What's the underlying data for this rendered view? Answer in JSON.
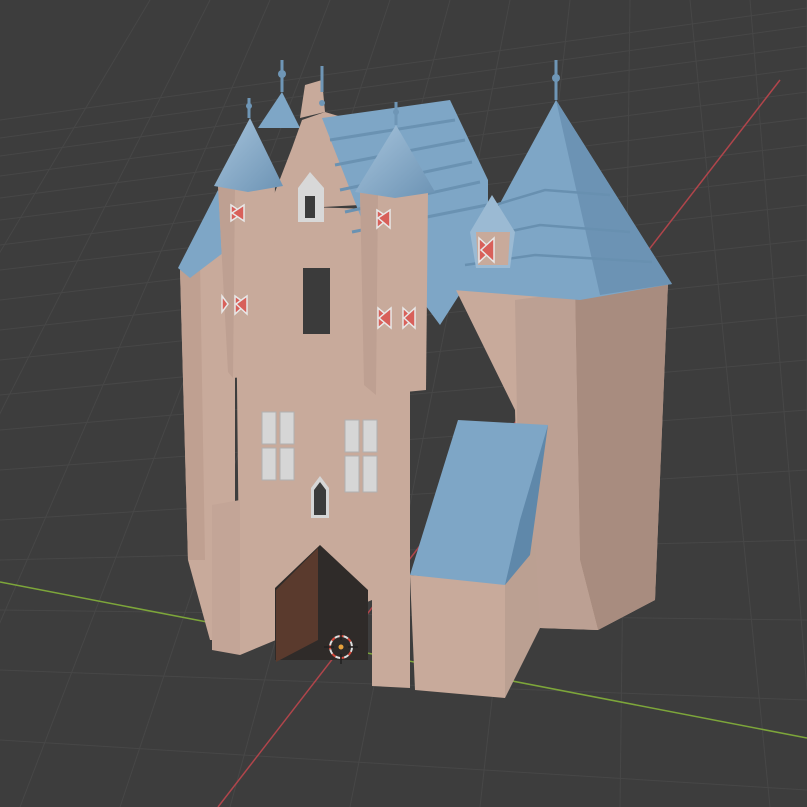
{
  "viewport": {
    "background": "#3d3d3d",
    "grid_color": "#474747",
    "axis_x_color": "#b0454b",
    "axis_y_color": "#7da63a"
  },
  "model": {
    "wall_color": "#c8aa9b",
    "wall_shade_color": "#a88c7f",
    "roof_color": "#7ea6c6",
    "roof_shade_color": "#5f88aa",
    "window_color": "#3b3b3b",
    "door_color": "#5a3a2d",
    "shutter_color": "#d8605a"
  },
  "cursor": {
    "icon": "3d-cursor-icon",
    "ring_color": "#e0e0e0",
    "center_color": "#e8a23c"
  }
}
